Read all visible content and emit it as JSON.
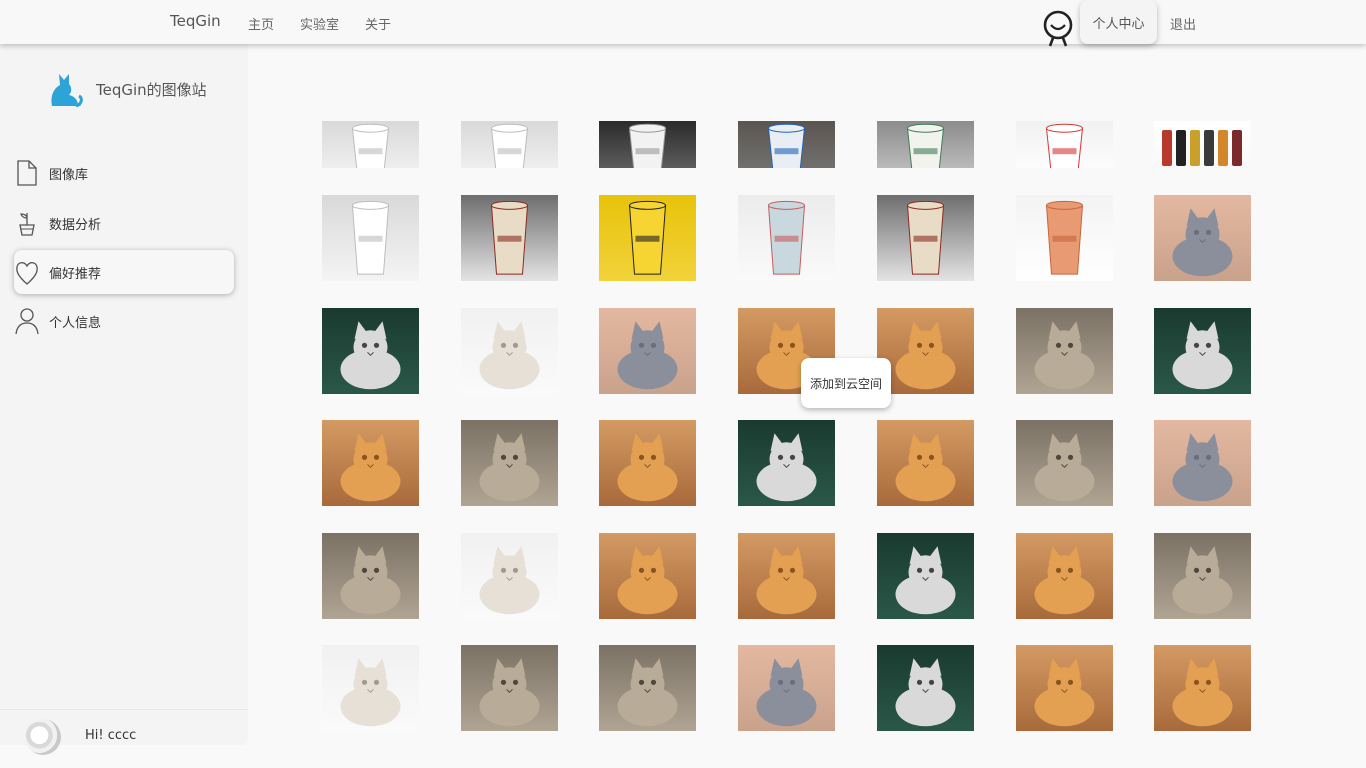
{
  "topbar": {
    "brand": "TeqGin",
    "nav": [
      "主页",
      "实验室",
      "关于"
    ],
    "profile_button": "个人中心",
    "logout": "退出"
  },
  "sidebar": {
    "site_title": "TeqGin的图像站",
    "menu": [
      {
        "label": "图像库",
        "icon": "file-icon"
      },
      {
        "label": "数据分析",
        "icon": "plant-icon"
      },
      {
        "label": "偏好推荐",
        "icon": "heart-icon",
        "active": true
      },
      {
        "label": "个人信息",
        "icon": "person-icon"
      }
    ],
    "greeting": "Hi! cccc"
  },
  "gallery": {
    "tooltip": "添加到云空间",
    "rows": [
      [
        "cup-white",
        "cup-white",
        "cup-dark",
        "cup-blue",
        "cup-green",
        "cup-red",
        "cup-color"
      ],
      [
        "cup-white",
        "cup-brown",
        "cup-yellow",
        "cup-drink",
        "cup-brown",
        "cup-orange",
        "cat-gray"
      ],
      [
        "cat-green",
        "cat-white",
        "cat-gray",
        "cat-orange",
        "cat-orange",
        "cat-tabby",
        "cat-green"
      ],
      [
        "cat-orange",
        "cat-tabby",
        "cat-orange",
        "cat-green",
        "cat-orange",
        "cat-tabby",
        "cat-gray"
      ],
      [
        "cat-tabby",
        "cat-white",
        "cat-orange",
        "cat-orange",
        "cat-green",
        "cat-orange",
        "cat-tabby"
      ],
      [
        "cat-white",
        "cat-tabby",
        "cat-tabby",
        "cat-gray",
        "cat-green",
        "cat-orange",
        "cat-orange"
      ]
    ]
  },
  "colors": {
    "accent_logo": "#2ea3d8",
    "topbar_bg": "#f8f8f8",
    "sidebar_bg": "#f4f4f4"
  }
}
